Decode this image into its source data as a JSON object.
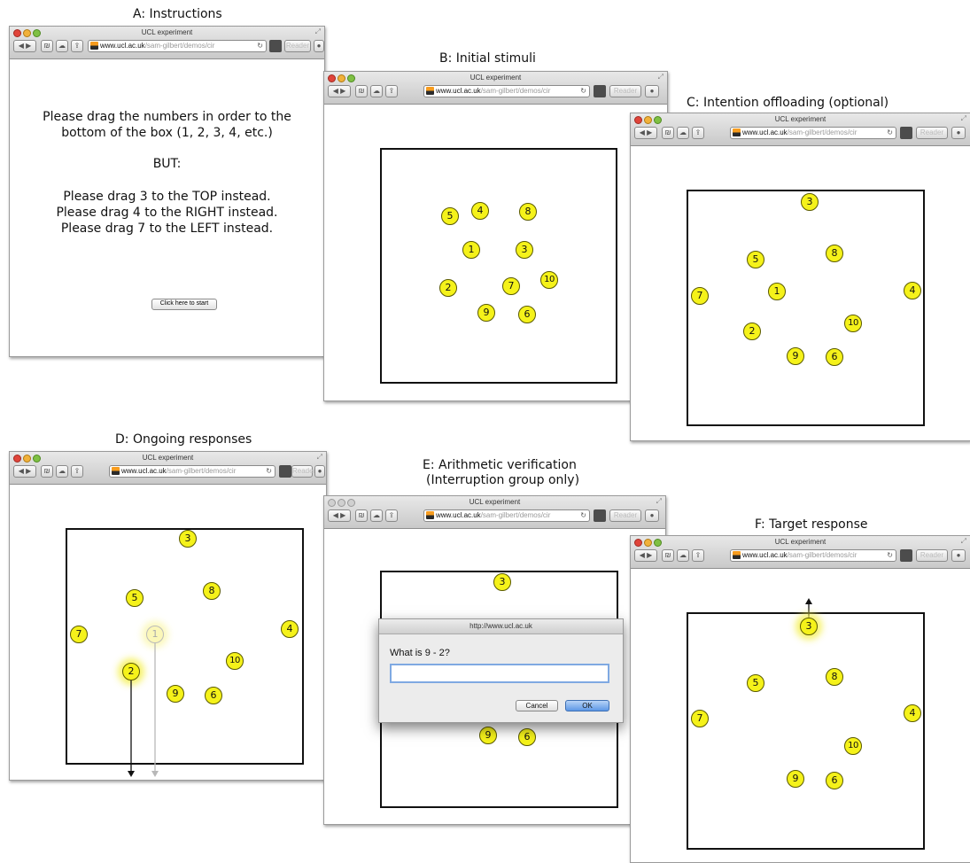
{
  "browser": {
    "window_title": "UCL experiment",
    "url_host": "www.ucl.ac.uk",
    "url_path": "/sam-gilbert/demos/cir",
    "reader_label": "Reader"
  },
  "panels": {
    "a": {
      "title": "A: Instructions",
      "line1": "Please drag the numbers in order to the",
      "line2": "bottom of the box (1, 2, 3, 4, etc.)",
      "but": "BUT:",
      "rule3": "Please drag 3 to the TOP instead.",
      "rule4": "Please drag 4 to the RIGHT instead.",
      "rule7": "Please drag 7 to the LEFT instead.",
      "start_button": "Click here to start"
    },
    "b": {
      "title": "B: Initial stimuli"
    },
    "c": {
      "title": "C: Intention offloading (optional)"
    },
    "d": {
      "title": "D: Ongoing responses"
    },
    "e": {
      "title_line1": "E: Arithmetic verification",
      "title_line2": "(Interruption group only)",
      "dialog_title": "http://www.ucl.ac.uk",
      "dialog_question": "What is 9 - 2?",
      "dialog_input_value": "",
      "cancel_label": "Cancel",
      "ok_label": "OK"
    },
    "f": {
      "title": "F: Target response"
    }
  },
  "circles": {
    "n1": "1",
    "n2": "2",
    "n3": "3",
    "n4": "4",
    "n5": "5",
    "n6": "6",
    "n7": "7",
    "n8": "8",
    "n9": "9",
    "n10": "10"
  },
  "colors": {
    "circle_fill": "#f5f21a",
    "box_border": "#111111",
    "ok_button": "#5d98e6"
  }
}
